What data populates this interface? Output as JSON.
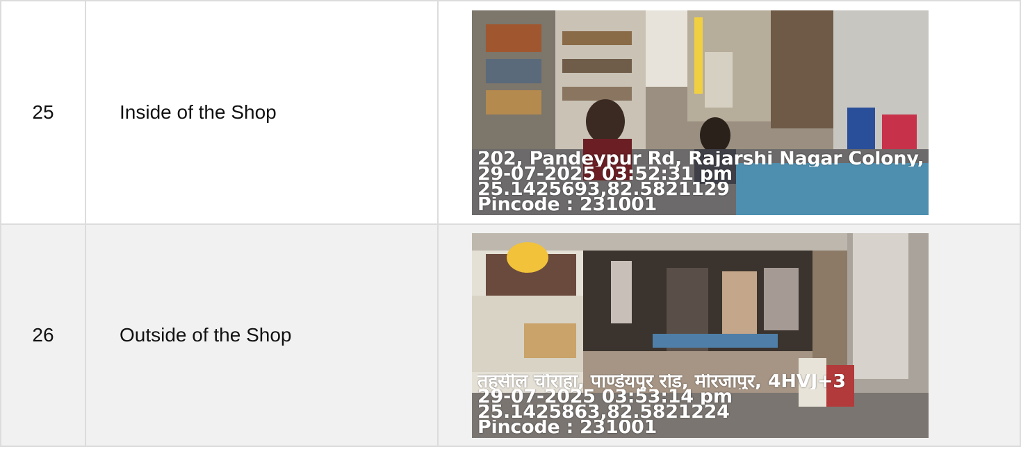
{
  "rows": [
    {
      "number": "25",
      "description": "Inside of the Shop",
      "photo": {
        "address": "202, Pandeypur Rd, Rajarshi Nagar Colony, ..",
        "datetime": "29-07-2025 03:52:31 pm",
        "coords": "25.1425693,82.5821129",
        "pincode": "Pincode : 231001"
      }
    },
    {
      "number": "26",
      "description": "Outside of the Shop",
      "photo": {
        "address": "तहसील चौराहा, पाण्डेयपुर रोड, मीरजापुर, 4HVJ+3",
        "datetime": "29-07-2025 03:53:14 pm",
        "coords": "25.1425863,82.5821224",
        "pincode": "Pincode : 231001"
      }
    }
  ]
}
